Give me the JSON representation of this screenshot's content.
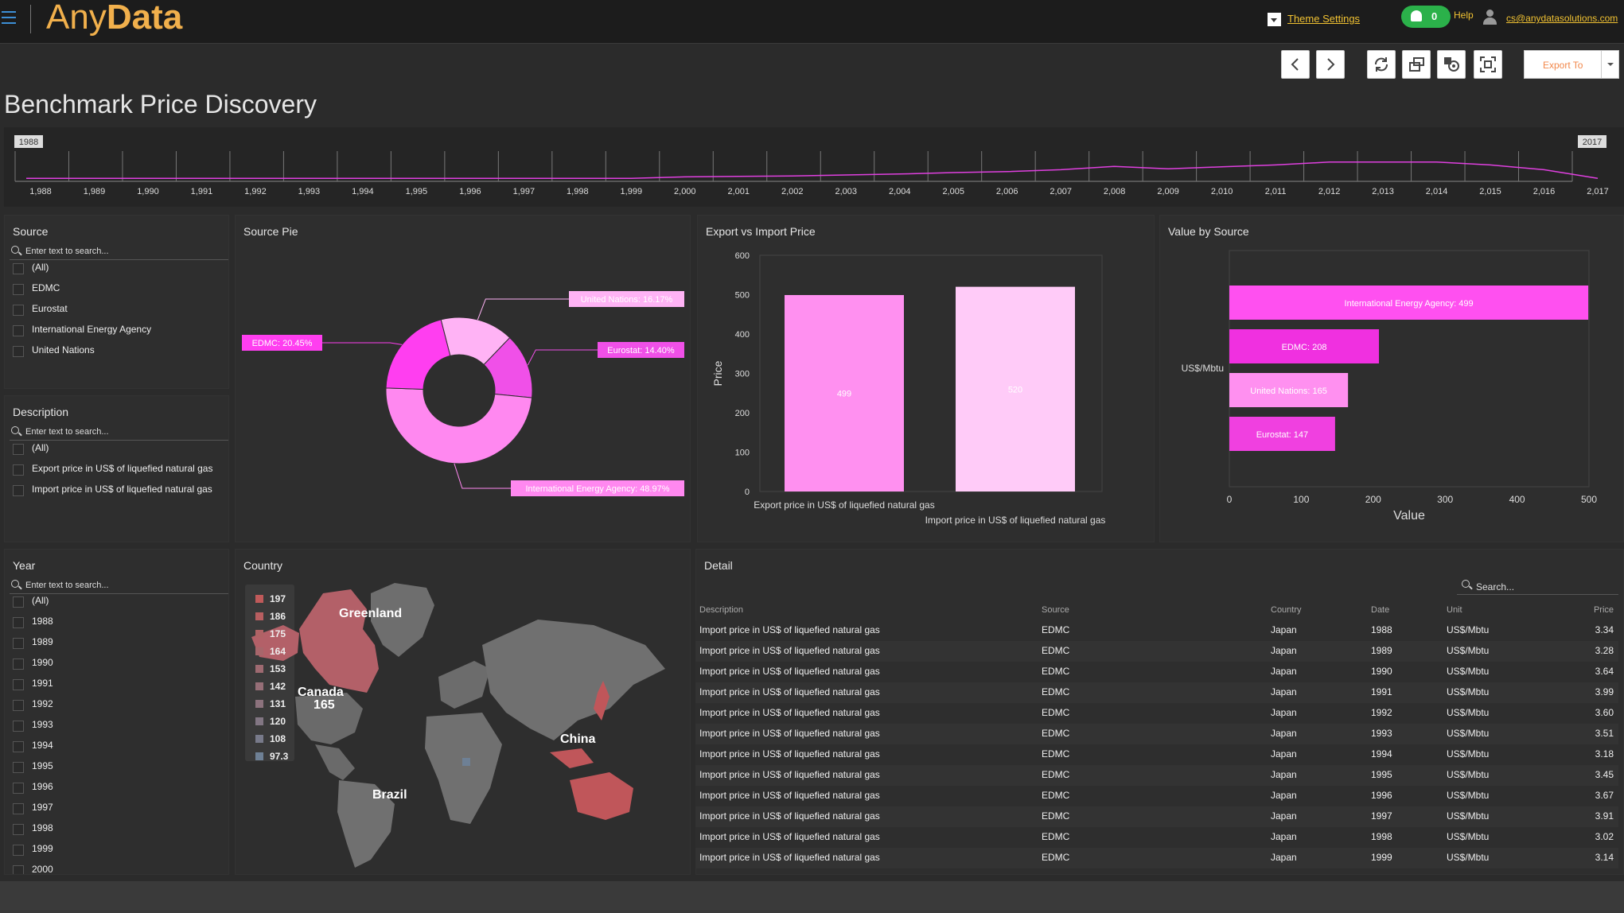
{
  "app": {
    "logo_any": "Any",
    "logo_data": "Data",
    "theme_settings": "Theme Settings",
    "notifications": "0",
    "help": "Help",
    "user_email": "cs@anydatasolutions.com"
  },
  "toolbar": {
    "back": "back-icon",
    "forward": "forward-icon",
    "refresh": "refresh-icon",
    "export": "Export To"
  },
  "page": {
    "title": "Benchmark Price Discovery"
  },
  "timeline": {
    "start_flag": "1988",
    "end_flag": "2017",
    "years": [
      "1,988",
      "1,989",
      "1,990",
      "1,991",
      "1,992",
      "1,993",
      "1,994",
      "1,995",
      "1,996",
      "1,997",
      "1,998",
      "1,999",
      "2,000",
      "2,001",
      "2,002",
      "2,003",
      "2,004",
      "2,005",
      "2,006",
      "2,007",
      "2,008",
      "2,009",
      "2,010",
      "2,011",
      "2,012",
      "2,013",
      "2,014",
      "2,015",
      "2,016",
      "2,017"
    ],
    "line_color": "#e040e0"
  },
  "filters": {
    "source": {
      "title": "Source",
      "placeholder": "Enter text to search...",
      "items": [
        "(All)",
        "EDMC",
        "Eurostat",
        "International Energy Agency",
        "United Nations"
      ]
    },
    "description": {
      "title": "Description",
      "placeholder": "Enter text to search...",
      "items": [
        "(All)",
        "Export price in US$ of liquefied natural gas",
        "Import price in US$ of liquefied natural gas"
      ]
    },
    "year": {
      "title": "Year",
      "placeholder": "Enter text to search...",
      "items": [
        "(All)",
        "1988",
        "1989",
        "1990",
        "1991",
        "1992",
        "1993",
        "1994",
        "1995",
        "1996",
        "1997",
        "1998",
        "1999",
        "2000"
      ]
    }
  },
  "source_pie": {
    "title": "Source Pie",
    "chart_data": {
      "type": "pie",
      "slices": [
        {
          "label": "United Nations",
          "value": 16.17,
          "text": "United Nations: 16.17%",
          "color": "#ffb3f5"
        },
        {
          "label": "Eurostat",
          "value": 14.4,
          "text": "Eurostat: 14.40%",
          "color": "#f050e8"
        },
        {
          "label": "International Energy Agency",
          "value": 48.97,
          "text": "International Energy Agency: 48.97%",
          "color": "#ff88f0"
        },
        {
          "label": "EDMC",
          "value": 20.45,
          "text": "EDMC: 20.45%",
          "color": "#ff3ef0"
        }
      ]
    }
  },
  "export_import": {
    "title": "Export vs Import Price",
    "chart_data": {
      "type": "bar",
      "categories": [
        "Export price in US$ of liquefied natural gas",
        "Import price in US$ of liquefied natural gas"
      ],
      "values": [
        499,
        520
      ],
      "value_labels": [
        "499",
        "520"
      ],
      "colors": [
        "#ff90f0",
        "#ffcbf8"
      ],
      "ylabel": "Price",
      "ylim": [
        0,
        600
      ],
      "yticks": [
        "0",
        "100",
        "200",
        "300",
        "400",
        "500",
        "600"
      ]
    }
  },
  "value_by_source": {
    "title": "Value by Source",
    "chart_data": {
      "type": "bar",
      "orientation": "horizontal",
      "category_axis_label": "US$/Mbtu",
      "categories": [
        "International Energy Agency",
        "EDMC",
        "United Nations",
        "Eurostat"
      ],
      "values": [
        499,
        208,
        165,
        147
      ],
      "value_labels": [
        "International Energy Agency: 499",
        "EDMC: 208",
        "United Nations: 165",
        "Eurostat: 147"
      ],
      "colors": [
        "#ff50f0",
        "#f030e0",
        "#ff90f0",
        "#f040e0"
      ],
      "xlabel": "Value",
      "xlim": [
        0,
        500
      ],
      "xticks": [
        "0",
        "100",
        "200",
        "300",
        "400",
        "500"
      ]
    }
  },
  "country": {
    "title": "Country",
    "legend": [
      {
        "label": "197",
        "color": "#c05a5a"
      },
      {
        "label": "186",
        "color": "#b85e60"
      },
      {
        "label": "175",
        "color": "#b06265"
      },
      {
        "label": "164",
        "color": "#a8666b"
      },
      {
        "label": "153",
        "color": "#9e6a71"
      },
      {
        "label": "142",
        "color": "#966e77"
      },
      {
        "label": "131",
        "color": "#8c727d"
      },
      {
        "label": "120",
        "color": "#827683"
      },
      {
        "label": "108",
        "color": "#787a8a"
      },
      {
        "label": "97.3",
        "color": "#6e8095"
      }
    ],
    "labels": {
      "greenland": "Greenland",
      "canada": "Canada",
      "canada_value": "165",
      "china": "China",
      "brazil": "Brazil"
    }
  },
  "detail": {
    "title": "Detail",
    "search_placeholder": "Search...",
    "columns": [
      "Description",
      "Source",
      "Country",
      "Date",
      "Unit",
      "Price"
    ],
    "rows": [
      [
        "Import price in US$ of liquefied natural gas",
        "EDMC",
        "Japan",
        "1988",
        "US$/Mbtu",
        "3.34"
      ],
      [
        "Import price in US$ of liquefied natural gas",
        "EDMC",
        "Japan",
        "1989",
        "US$/Mbtu",
        "3.28"
      ],
      [
        "Import price in US$ of liquefied natural gas",
        "EDMC",
        "Japan",
        "1990",
        "US$/Mbtu",
        "3.64"
      ],
      [
        "Import price in US$ of liquefied natural gas",
        "EDMC",
        "Japan",
        "1991",
        "US$/Mbtu",
        "3.99"
      ],
      [
        "Import price in US$ of liquefied natural gas",
        "EDMC",
        "Japan",
        "1992",
        "US$/Mbtu",
        "3.60"
      ],
      [
        "Import price in US$ of liquefied natural gas",
        "EDMC",
        "Japan",
        "1993",
        "US$/Mbtu",
        "3.51"
      ],
      [
        "Import price in US$ of liquefied natural gas",
        "EDMC",
        "Japan",
        "1994",
        "US$/Mbtu",
        "3.18"
      ],
      [
        "Import price in US$ of liquefied natural gas",
        "EDMC",
        "Japan",
        "1995",
        "US$/Mbtu",
        "3.45"
      ],
      [
        "Import price in US$ of liquefied natural gas",
        "EDMC",
        "Japan",
        "1996",
        "US$/Mbtu",
        "3.67"
      ],
      [
        "Import price in US$ of liquefied natural gas",
        "EDMC",
        "Japan",
        "1997",
        "US$/Mbtu",
        "3.91"
      ],
      [
        "Import price in US$ of liquefied natural gas",
        "EDMC",
        "Japan",
        "1998",
        "US$/Mbtu",
        "3.02"
      ],
      [
        "Import price in US$ of liquefied natural gas",
        "EDMC",
        "Japan",
        "1999",
        "US$/Mbtu",
        "3.14"
      ]
    ]
  }
}
